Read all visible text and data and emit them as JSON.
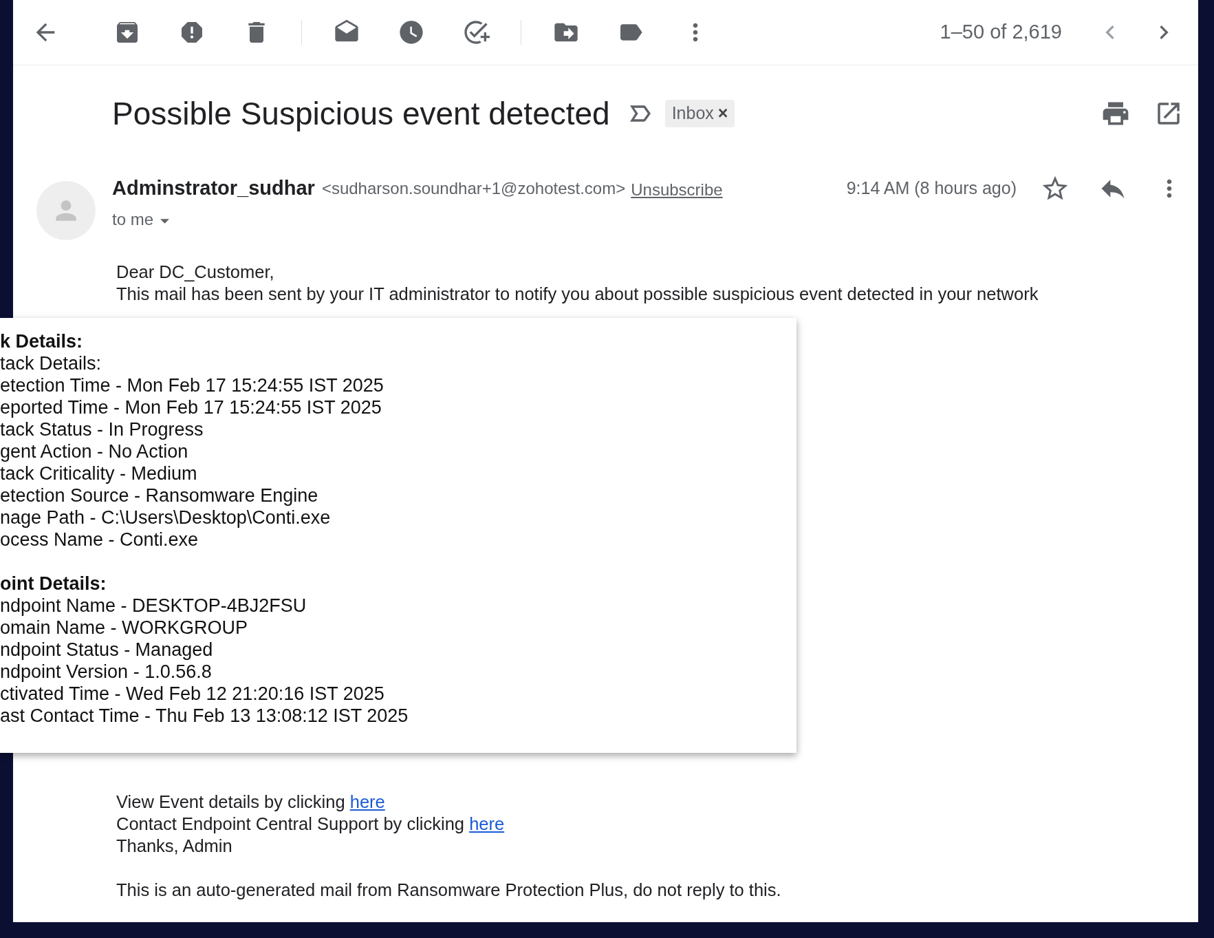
{
  "toolbar": {
    "pagination": "1–50 of 2,619"
  },
  "email": {
    "subject": "Possible Suspicious event detected",
    "important": false,
    "labels": [
      {
        "text": "Inbox",
        "close": "×"
      }
    ],
    "sender": {
      "name": "Adminstrator_sudhar",
      "address": "<sudharson.soundhar+1@zohotest.com>",
      "unsubscribe": "Unsubscribe"
    },
    "time": "9:14 AM (8 hours ago)",
    "starred": false,
    "recipient": "to me",
    "body_intro": [
      "Dear DC_Customer,",
      "This mail has been sent by your IT administrator to notify you about possible suspicious event detected in your network"
    ],
    "details_card": [
      {
        "heading": "k Details:",
        "lines": [
          "tack Details:",
          "etection Time - Mon Feb 17 15:24:55 IST 2025",
          "eported Time - Mon Feb 17 15:24:55 IST 2025",
          "tack Status - In Progress",
          "gent Action - No Action",
          "tack Criticality - Medium",
          "etection Source - Ransomware Engine",
          "nage Path - C:\\Users\\Desktop\\Conti.exe",
          "ocess Name - Conti.exe"
        ]
      },
      {
        "heading": "oint Details:",
        "lines": [
          "ndpoint Name - DESKTOP-4BJ2FSU",
          "omain Name - WORKGROUP",
          "ndpoint Status - Managed",
          "ndpoint Version - 1.0.56.8",
          "ctivated Time - Wed Feb 12 21:20:16 IST 2025",
          "ast Contact Time - Thu Feb 13 13:08:12 IST 2025"
        ]
      }
    ],
    "body_links": [
      {
        "text": "View Event details by clicking",
        "link": "here"
      },
      {
        "text": "Contact Endpoint Central Support by clicking",
        "link": "here"
      },
      {
        "text": "Thanks, Admin"
      }
    ],
    "footer_note": "This is an auto-generated mail from Ransomware Protection Plus, do not reply to this."
  }
}
